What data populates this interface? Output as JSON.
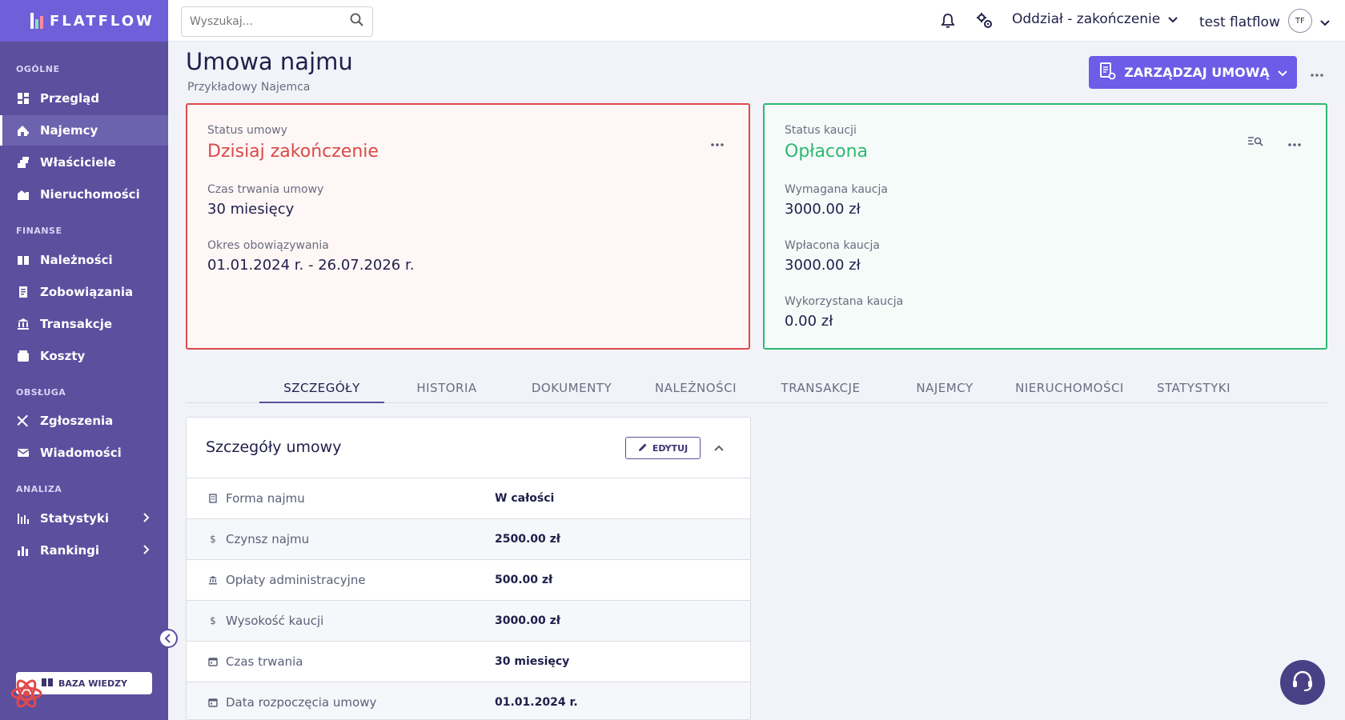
{
  "brand": {
    "name": "FLATFLOW"
  },
  "sidebar": {
    "sections": {
      "general": "OGÓLNE",
      "finance": "FINANSE",
      "service": "OBSŁUGA",
      "analysis": "ANALIZA"
    },
    "items": {
      "overview": "Przegląd",
      "tenants": "Najemcy",
      "owners": "Właściciele",
      "properties": "Nieruchomości",
      "receivables": "Należności",
      "liabilities": "Zobowiązania",
      "transactions": "Transakcje",
      "costs": "Koszty",
      "reports": "Zgłoszenia",
      "messages": "Wiadomości",
      "statistics": "Statystyki",
      "rankings": "Rankingi"
    },
    "knowledge_base": "BAZA WIEDZY"
  },
  "topbar": {
    "search_placeholder": "Wyszukaj...",
    "branch": "Oddział - zakończenie",
    "user": "test flatflow",
    "avatar_initials": "TF"
  },
  "page": {
    "title": "Umowa najmu",
    "subtitle": "Przykładowy Najemca",
    "manage_button": "ZARZĄDZAJ UMOWĄ"
  },
  "contract_card": {
    "status_label": "Status umowy",
    "status_value": "Dzisiaj zakończenie",
    "duration_label": "Czas trwania umowy",
    "duration_value": "30 miesięcy",
    "period_label": "Okres obowiązywania",
    "period_value": "01.01.2024 r. - 26.07.2026 r."
  },
  "deposit_card": {
    "status_label": "Status kaucji",
    "status_value": "Opłacona",
    "required_label": "Wymagana kaucja",
    "required_value": "3000.00 zł",
    "paid_label": "Wpłacona kaucja",
    "paid_value": "3000.00 zł",
    "used_label": "Wykorzystana kaucja",
    "used_value": "0.00 zł"
  },
  "tabs": [
    "SZCZEGÓŁY",
    "HISTORIA",
    "DOKUMENTY",
    "NALEŻNOŚCI",
    "TRANSAKCJE",
    "NAJEMCY",
    "NIERUCHOMOŚCI",
    "STATYSTYKI"
  ],
  "details": {
    "title": "Szczegóły umowy",
    "edit_label": "EDYTUJ",
    "rows": [
      {
        "label": "Forma najmu",
        "value": "W całości",
        "icon": "building-icon"
      },
      {
        "label": "Czynsz najmu",
        "value": "2500.00 zł",
        "icon": "dollar-icon"
      },
      {
        "label": "Opłaty administracyjne",
        "value": "500.00 zł",
        "icon": "bank-icon"
      },
      {
        "label": "Wysokość kaucji",
        "value": "3000.00 zł",
        "icon": "dollar-icon"
      },
      {
        "label": "Czas trwania",
        "value": "30 miesięcy",
        "icon": "calendar-icon"
      },
      {
        "label": "Data rozpoczęcia umowy",
        "value": "01.01.2024 r.",
        "icon": "calendar-icon"
      }
    ]
  },
  "colors": {
    "sidebar_bg": "#5b4f9e",
    "brand_bg": "#6f5fd8",
    "accent": "#6c5ce7",
    "danger": "#d84a47",
    "success": "#2eb873"
  }
}
